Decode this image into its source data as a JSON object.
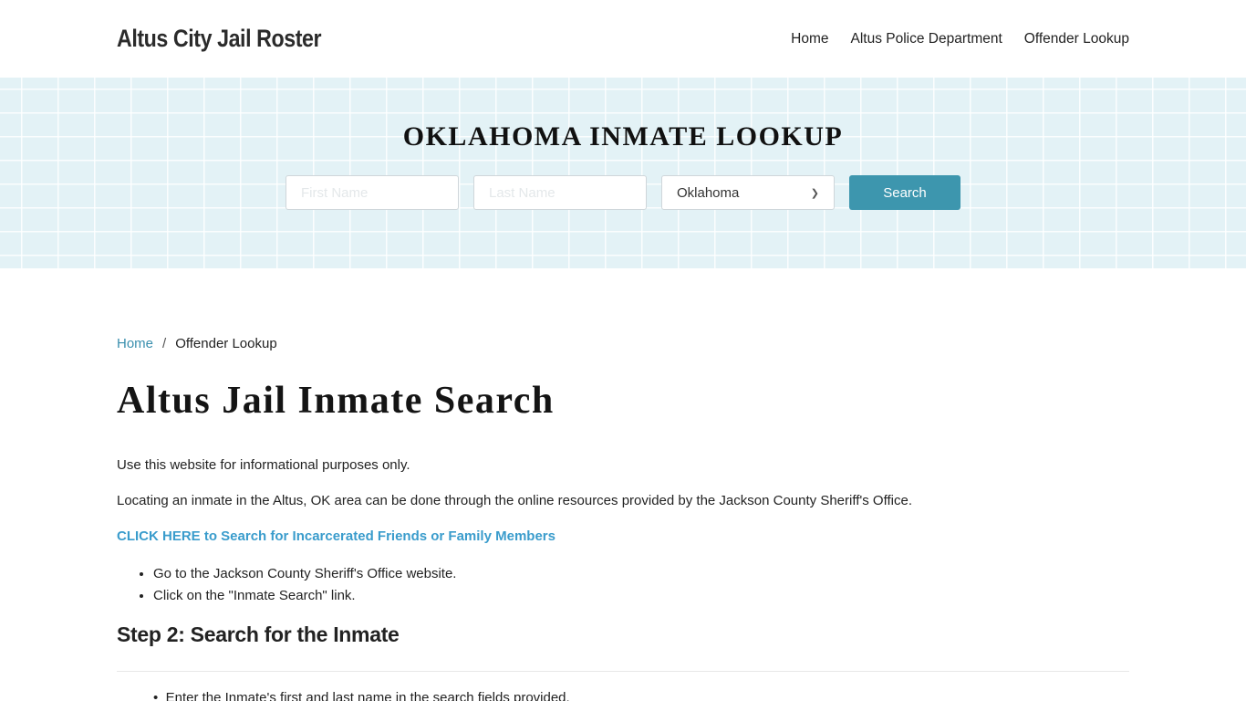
{
  "header": {
    "brand": "Altus City Jail Roster",
    "nav": [
      "Home",
      "Altus Police Department",
      "Offender Lookup"
    ]
  },
  "hero": {
    "title": "OKLAHOMA INMATE LOOKUP",
    "first_name_placeholder": "First Name",
    "last_name_placeholder": "Last Name",
    "state_selected": "Oklahoma",
    "search_label": "Search",
    "accent_color": "#3d96ae"
  },
  "breadcrumb": {
    "home": "Home",
    "separator": "/",
    "current": "Offender Lookup"
  },
  "main": {
    "title": "Altus Jail Inmate Search",
    "paragraphs": [
      "Use this website for informational purposes only.",
      "Locating an inmate in the Altus, OK area can be done through the online resources provided by the Jackson County Sheriff's Office."
    ],
    "cta_link": "CLICK HERE to Search for Incarcerated Friends or Family Members",
    "list_items": [
      "Go to the Jackson County Sheriff's Office website.",
      "Click on the \"Inmate Search\" link."
    ],
    "step2_heading": "Step 2: Search for the Inmate",
    "step2_first_item_partial": "Enter the Inmate's first and last name in the search fields provided."
  }
}
